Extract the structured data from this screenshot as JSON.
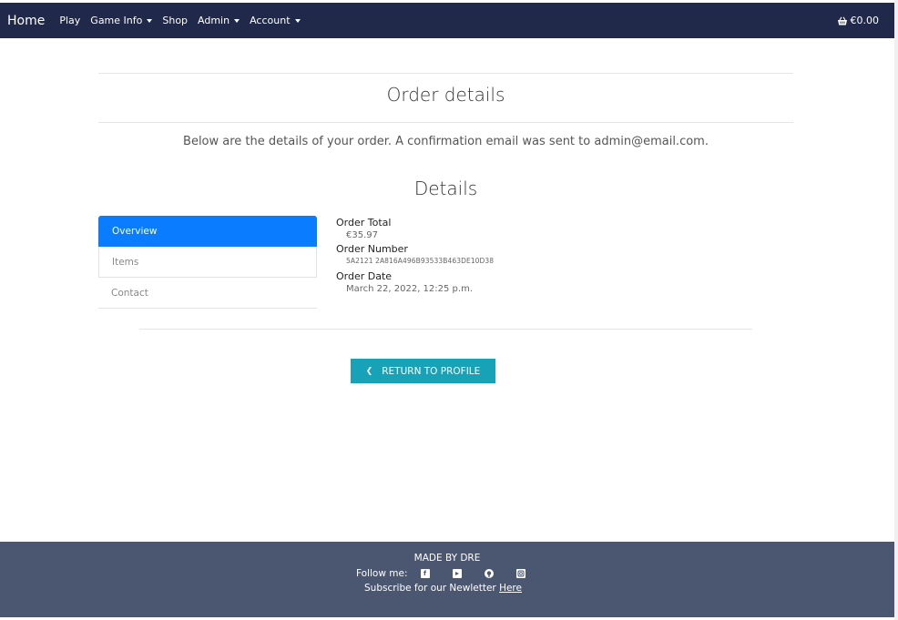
{
  "navbar": {
    "brand": "Home",
    "links": [
      {
        "label": "Play",
        "dropdown": false
      },
      {
        "label": "Game Info",
        "dropdown": true
      },
      {
        "label": "Shop",
        "dropdown": false
      },
      {
        "label": "Admin",
        "dropdown": true
      },
      {
        "label": "Account",
        "dropdown": true
      }
    ],
    "cart_total": "€0.00",
    "cart_icon": "basket-icon"
  },
  "main": {
    "title": "Order details",
    "subtitle": "Below are the details of your order. A confirmation email was sent to admin@email.com.",
    "section_title": "Details",
    "tabs": [
      {
        "label": "Overview",
        "active": true
      },
      {
        "label": "Items",
        "active": false
      },
      {
        "label": "Contact",
        "active": false
      }
    ],
    "details": {
      "total_label": "Order Total",
      "total_value": "€35.97",
      "number_label": "Order Number",
      "number_value": "5A2121 2A816A496B93533B463DE10D38",
      "date_label": "Order Date",
      "date_value": "March 22, 2022, 12:25 p.m."
    },
    "return_button": "RETURN TO PROFILE"
  },
  "footer": {
    "made_by": "MADE BY DRE",
    "follow_label": "Follow me:",
    "social_icons": [
      "facebook-icon",
      "youtube-icon",
      "github-icon",
      "instagram-icon"
    ],
    "subscribe_text": "Subscribe for our Newletter",
    "subscribe_link": "Here"
  },
  "colors": {
    "navbar_bg": "#21294a",
    "footer_bg": "#4b5670",
    "active_tab": "#0a7cff",
    "button": "#17a2b8"
  }
}
